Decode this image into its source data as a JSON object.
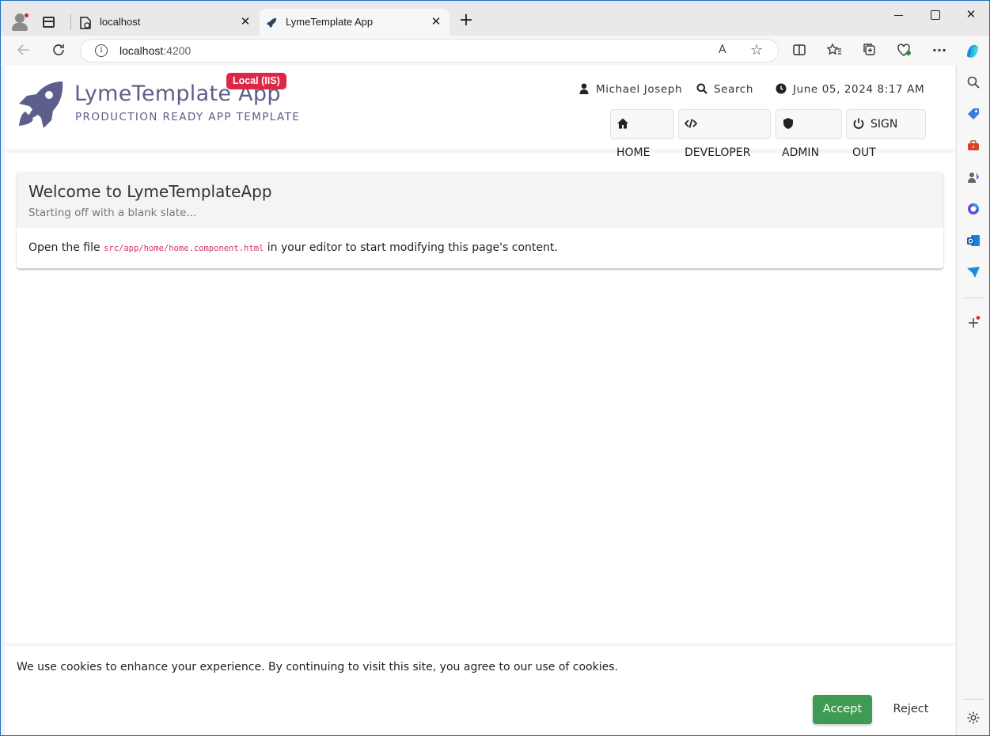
{
  "browser": {
    "tabs": [
      {
        "title": "localhost",
        "icon": "page-icon",
        "active": false
      },
      {
        "title": "LymeTemplate App",
        "icon": "rocket-icon",
        "active": true
      }
    ],
    "close_glyph": "✕",
    "new_tab_glyph": "+",
    "address": {
      "host": "localhost",
      "port": ":4200"
    },
    "read_aloud_glyph": "A",
    "favorite_glyph": "☆",
    "menu_glyph": "···",
    "accent": "#1f6fc5"
  },
  "app": {
    "brand_title": "LymeTemplate App",
    "brand_subtitle": "PRODUCTION READY APP TEMPLATE",
    "env_badge": "Local (IIS)",
    "brand_color": "#5c5f8a",
    "badge_color": "#dc2845",
    "user_name": "Michael Joseph",
    "search_label": "Search",
    "datetime": "June 05, 2024 8:17 AM",
    "nav": {
      "home": "HOME",
      "developer": "DEVELOPER",
      "admin": "ADMIN",
      "signout": "SIGN OUT"
    }
  },
  "welcome": {
    "title": "Welcome to LymeTemplateApp",
    "subtitle": "Starting off with a blank slate...",
    "body_before": "Open the file ",
    "body_code": "src/app/home/home.component.html",
    "body_after": " in your editor to start modifying this page's content."
  },
  "cookie": {
    "message": "We use cookies to enhance your experience. By continuing to visit this site, you agree to our use of cookies.",
    "accept": "Accept",
    "reject": "Reject",
    "accept_color": "#3f9b53"
  }
}
